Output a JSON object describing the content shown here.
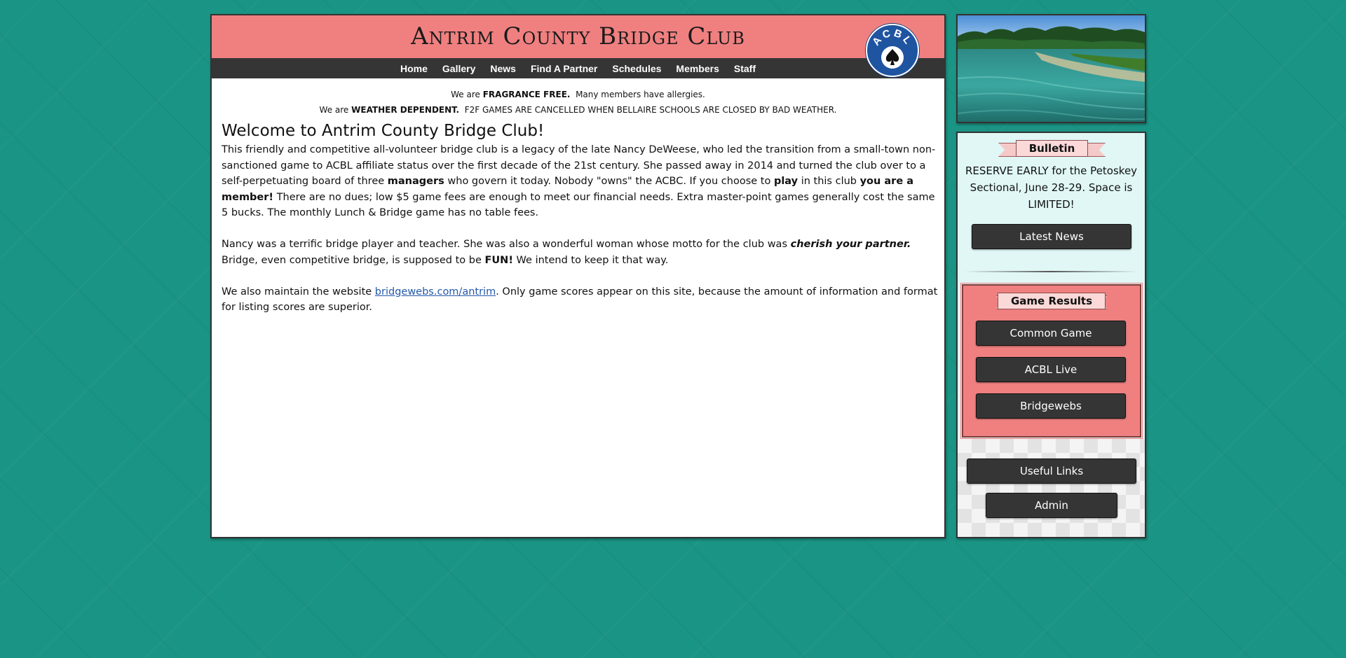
{
  "header": {
    "site_title": "Antrim County Bridge Club",
    "logo_text": "ACBL"
  },
  "nav": {
    "items": [
      {
        "label": "Home"
      },
      {
        "label": "Gallery"
      },
      {
        "label": "News"
      },
      {
        "label": "Find A Partner"
      },
      {
        "label": "Schedules"
      },
      {
        "label": "Members"
      },
      {
        "label": "Staff"
      }
    ]
  },
  "notices": {
    "fragrance_prefix": "We are ",
    "fragrance_bold": "FRAGRANCE FREE.",
    "fragrance_rest": "  Many members have allergies.",
    "weather_prefix": "We are ",
    "weather_bold": "WEATHER DEPENDENT.",
    "weather_rest": "  F2F GAMES ARE CANCELLED WHEN BELLAIRE SCHOOLS ARE CLOSED BY BAD WEATHER."
  },
  "main": {
    "heading": "Welcome to Antrim County Bridge Club!",
    "p1_a": "This friendly and competitive all-volunteer bridge club is a legacy of the late Nancy DeWeese, who led the transition from a small-town non-sanctioned game to ACBL affiliate status over the first decade of the 21st century.  She passed away in 2014 and turned the club over to a self-perpetuating board of three ",
    "p1_managers": "managers",
    "p1_b": " who govern it today.  Nobody \"owns\" the ACBC.  If you choose to ",
    "p1_play": "play",
    "p1_c": " in this club ",
    "p1_member": "you are a member!",
    "p1_d": "  There are no dues; low $5 game fees are enough to meet our financial needs.  Extra master-point games generally cost the same 5 bucks.  The monthly Lunch & Bridge game has no table fees.",
    "p2_a": "Nancy was a terrific bridge player and teacher.  She was also a wonderful woman whose motto for the club was ",
    "p2_motto": "cherish your partner.",
    "p2_b": "  Bridge, even competitive bridge, is supposed to be ",
    "p2_fun": "FUN!",
    "p2_c": "  We intend to keep it that way.",
    "p3_a": "We also maintain the website ",
    "p3_link": "bridgewebs.com/antrim",
    "p3_b": ".  Only game scores appear on this site, because the amount of information and format for listing scores are superior."
  },
  "sidebar": {
    "bulletin_title": "Bulletin",
    "bulletin_text": "RESERVE EARLY for the Petoskey Sectional, June 28-29. Space is LIMITED!",
    "latest_news_label": "Latest News",
    "game_results_title": "Game Results",
    "common_game_label": "Common Game",
    "acbl_live_label": "ACBL Live",
    "bridgewebs_label": "Bridgewebs",
    "useful_links_label": "Useful Links",
    "admin_label": "Admin"
  },
  "colors": {
    "page_background": "#1a9484",
    "header_band": "#f08080",
    "nav_bar": "#353535",
    "link": "#2458a8",
    "results_box": "#f08080",
    "sidebar_background": "#e0f7f6"
  },
  "icons": {
    "logo": "acbl-spade-logo-icon",
    "photo": "lake-shoreline-photo"
  }
}
